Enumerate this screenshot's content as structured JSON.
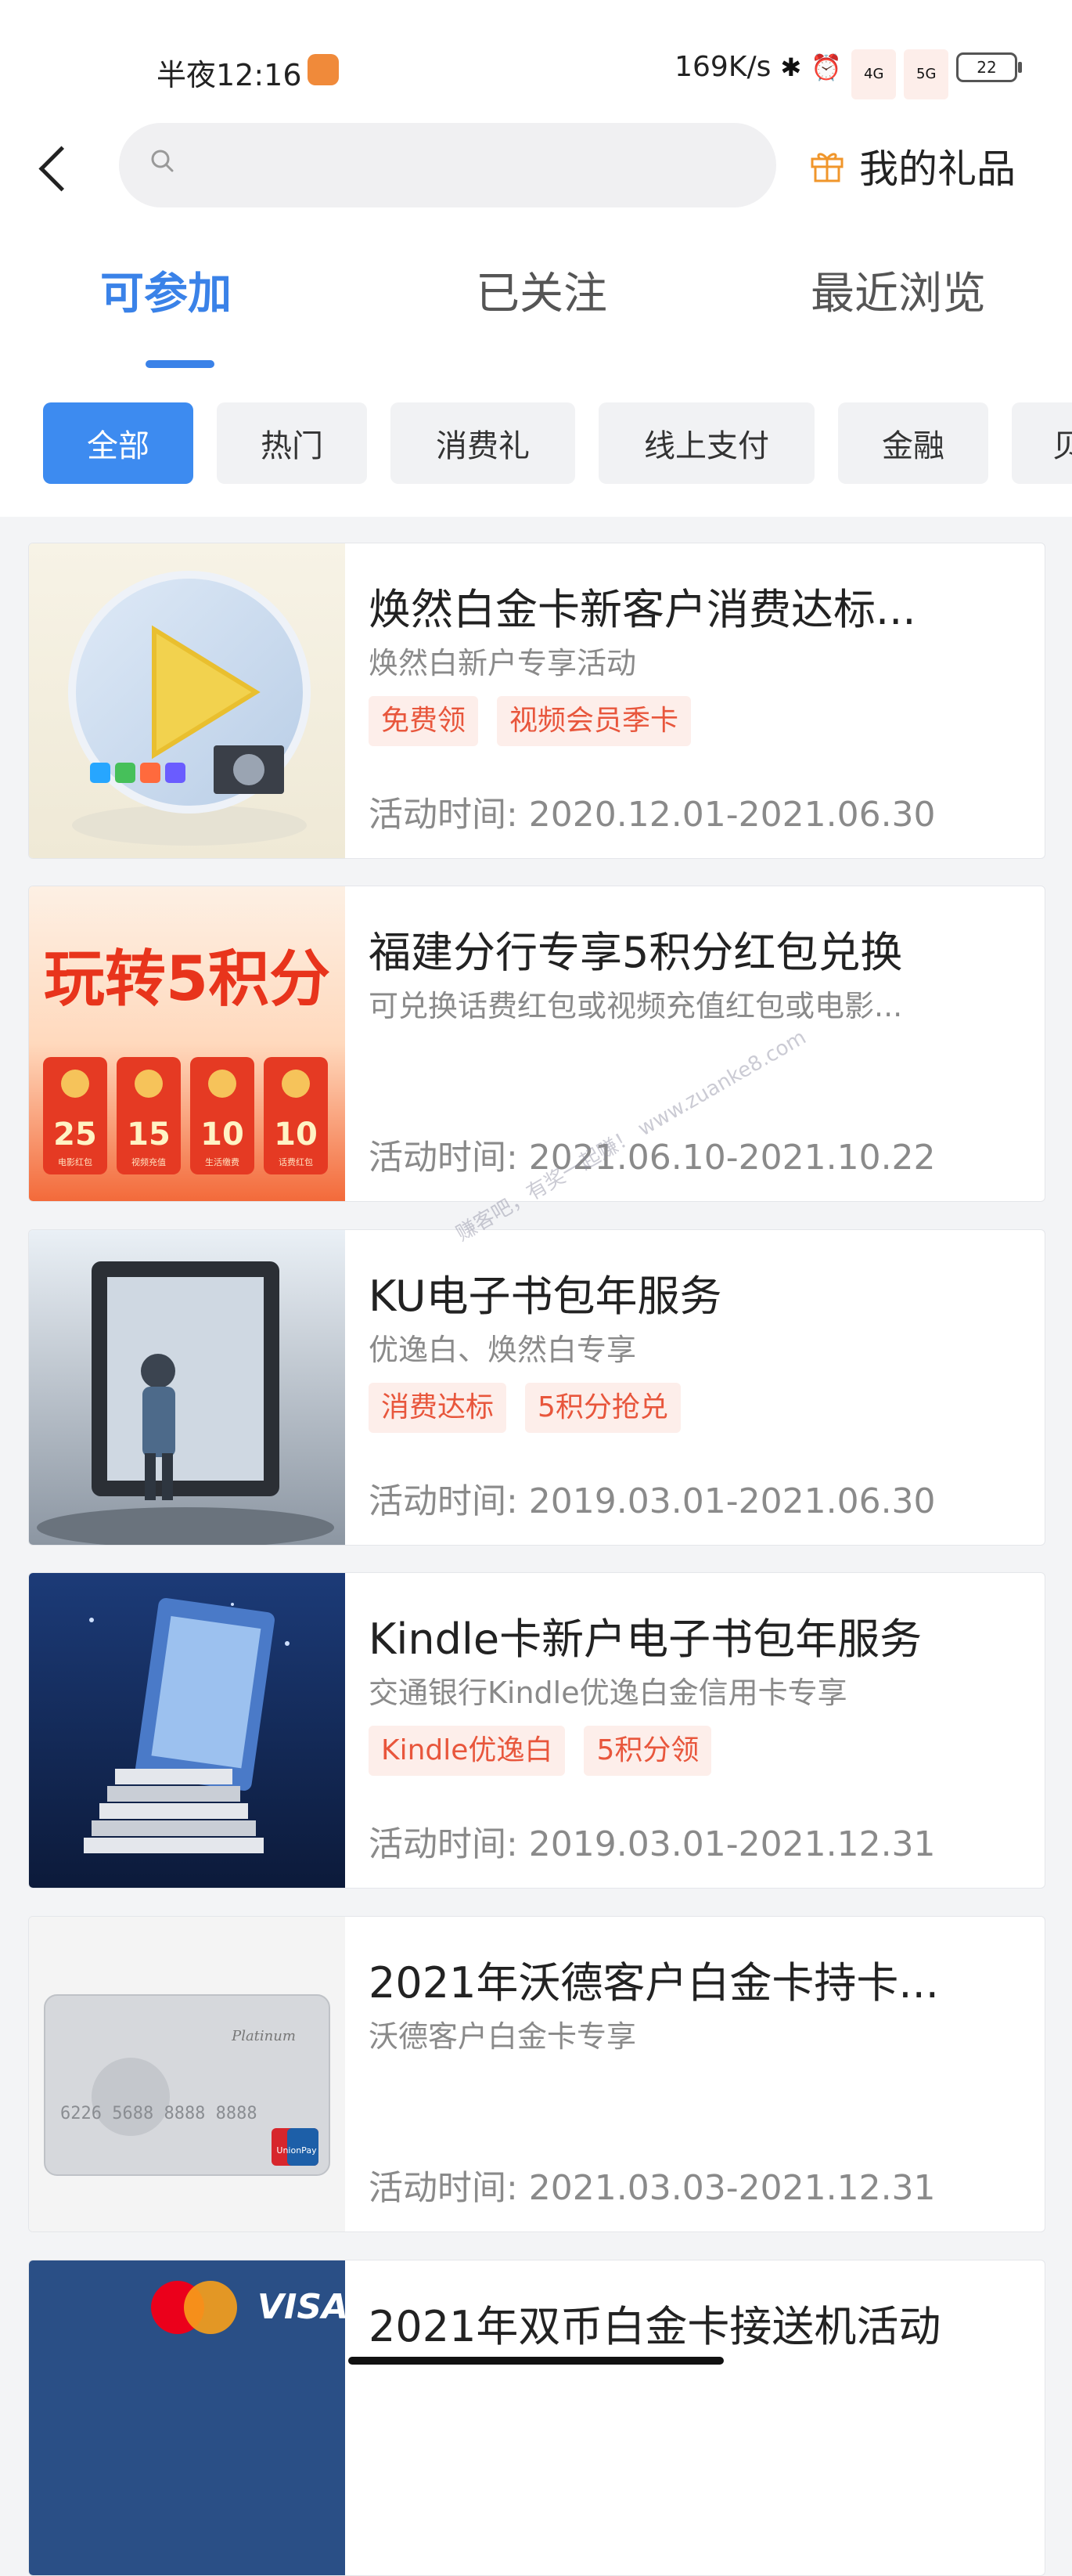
{
  "status_bar": {
    "time": "半夜12:16",
    "network_speed": "169K/s",
    "signal_4g": "4G",
    "signal_5g": "5G",
    "battery": "22"
  },
  "header": {
    "search_placeholder": "",
    "gift_label": "我的礼品"
  },
  "tabs": [
    {
      "label": "可参加",
      "active": true
    },
    {
      "label": "已关注",
      "active": false
    },
    {
      "label": "最近浏览",
      "active": false
    }
  ],
  "filters": [
    {
      "label": "全部",
      "active": true
    },
    {
      "label": "热门",
      "active": false
    },
    {
      "label": "消费礼",
      "active": false
    },
    {
      "label": "线上支付",
      "active": false
    },
    {
      "label": "金融",
      "active": false
    },
    {
      "label": "贝",
      "active": false
    }
  ],
  "activities": [
    {
      "title": "焕然白金卡新客户消费达标...",
      "subtitle": "焕然白新户专享活动",
      "tags": [
        "免费领",
        "视频会员季卡"
      ],
      "time": "活动时间: 2020.12.01-2021.06.30"
    },
    {
      "title": "福建分行专享5积分红包兑换",
      "subtitle": "可兑换话费红包或视频充值红包或电影...",
      "tags": [],
      "time": "活动时间: 2021.06.10-2021.10.22",
      "thumb_text": {
        "headline": "玩转5积分",
        "amounts": [
          "25",
          "15",
          "10",
          "10"
        ],
        "captions": [
          "电影红包",
          "视频充值",
          "生活缴费",
          "话费红包"
        ]
      }
    },
    {
      "title": "KU电子书包年服务",
      "subtitle": "优逸白、焕然白专享",
      "tags": [
        "消费达标",
        "5积分抢兑"
      ],
      "time": "活动时间: 2019.03.01-2021.06.30"
    },
    {
      "title": "Kindle卡新户电子书包年服务",
      "subtitle": "交通银行Kindle优逸白金信用卡专享",
      "tags": [
        "Kindle优逸白",
        "5积分领"
      ],
      "time": "活动时间: 2019.03.01-2021.12.31"
    },
    {
      "title": "2021年沃德客户白金卡持卡...",
      "subtitle": "沃德客户白金卡专享",
      "tags": [],
      "time": "活动时间: 2021.03.03-2021.12.31",
      "thumb_text": {
        "card_line": "Platinum",
        "card_number": "6226 5688 8888 8888",
        "union_pay": "UnionPay"
      }
    },
    {
      "title": "2021年双币白金卡接送机活动",
      "subtitle": "",
      "tags": [],
      "time": "",
      "thumb_text": {
        "brand": "VISA"
      }
    }
  ],
  "watermark": "赚客吧，有奖一起赚！ www.zuanke8.com",
  "colors": {
    "accent": "#3a82e8",
    "tag_text": "#e8563c",
    "tag_bg": "#fdeeea",
    "gift_icon": "#f0962b"
  }
}
